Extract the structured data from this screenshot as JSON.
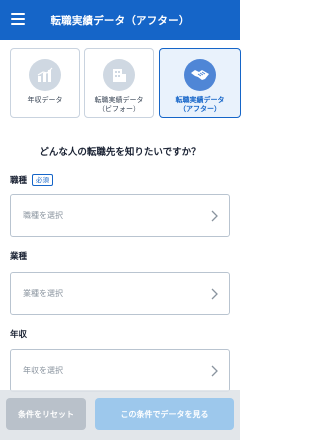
{
  "header": {
    "title": "転職実績データ（アフター）",
    "menu_icon": "hamburger-menu-icon"
  },
  "tabs": [
    {
      "label": "年収データ",
      "icon": "bar-chart-icon",
      "selected": false
    },
    {
      "label": "転職実績データ\n（ビフォー）",
      "icon": "building-icon",
      "selected": false
    },
    {
      "label": "転職実績データ\n（アフター）",
      "icon": "handshake-icon",
      "selected": true
    }
  ],
  "question": "どんな人の転職先を知りたいですか？",
  "fields": {
    "job_type": {
      "label": "職種",
      "required_badge": "必須",
      "placeholder": "職種を選択"
    },
    "industry": {
      "label": "業種",
      "placeholder": "業種を選択"
    },
    "income": {
      "label": "年収",
      "placeholder": "年収を選択"
    }
  },
  "actions": {
    "reset_label": "条件をリセット",
    "search_label": "この条件でデータを見る"
  },
  "colors": {
    "primary": "#1565c8",
    "selected_tab_bg": "#e9f2fc"
  }
}
